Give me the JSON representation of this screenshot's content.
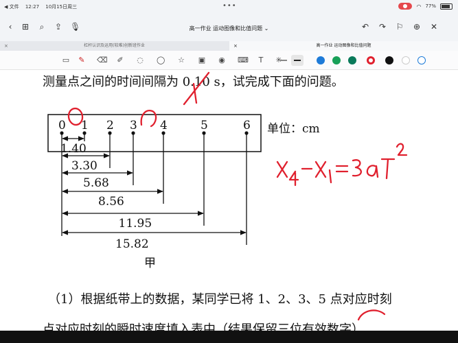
{
  "status": {
    "left": [
      "◀ 文件",
      "12:27",
      "10月15日周三"
    ],
    "battery": "77%"
  },
  "nav": {
    "title": "高一作业 运动图像和比值问题 ⌄"
  },
  "tabs": [
    {
      "label": "杠杆认识及运用(较难)创新班作业"
    },
    {
      "label": "高一作业 运动图像和比值问题"
    }
  ],
  "document": {
    "line1": "测量点之间的时间间隔为 0.10 s，试完成下面的问题。",
    "points": [
      "0",
      "1",
      "2",
      "3",
      "4",
      "5",
      "6"
    ],
    "unit": "单位：cm",
    "distances": [
      "1.40",
      "3.30",
      "5.68",
      "8.56",
      "11.95",
      "15.82"
    ],
    "caption": "甲",
    "line_q1": "（1）根据纸带上的数据，某同学已将 1、2、3、5 点对应时刻",
    "line_q2": "点对应时刻的瞬时速度填入表中（结果保留三位有效数字）"
  },
  "annotation": {
    "formula": "x4 - x1 = 3aT²",
    "color": "#e0202e"
  },
  "colors": {
    "swatches": [
      "#1e7bd8",
      "#18a058",
      "#0a7a5a",
      "#e0202e",
      "#111111",
      "#ffffff"
    ]
  }
}
